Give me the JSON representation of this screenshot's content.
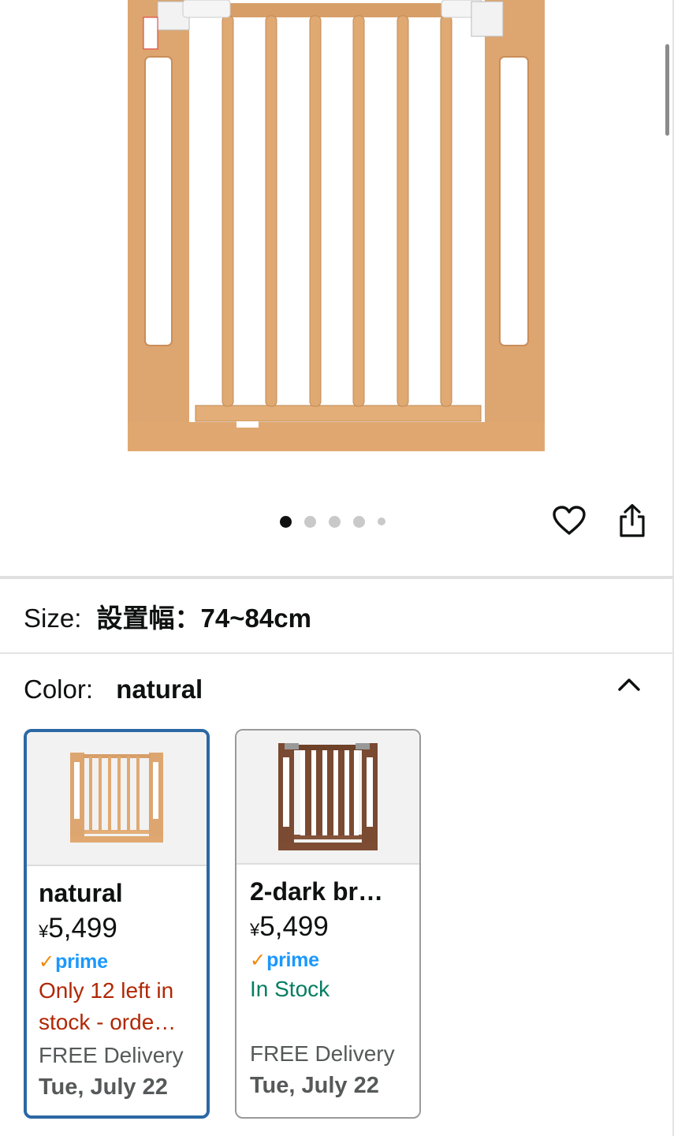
{
  "product_images": {
    "count": 5,
    "active_index": 0
  },
  "actions": {
    "wishlist_icon": "heart-icon",
    "share_icon": "share-icon"
  },
  "size": {
    "label": "Size:",
    "value": "設置幅：74~84cm"
  },
  "color": {
    "label": "Color:",
    "value": "natural",
    "toggle_icon": "chevron-up-icon"
  },
  "swatches": [
    {
      "name": "natural",
      "currency": "¥",
      "price": "5,499",
      "prime": "prime",
      "availability": "Only 12 left in stock - orde…",
      "delivery_label": "FREE Delivery",
      "delivery_date": "Tue, July 22",
      "wood_color": "#d9a46c",
      "selected": true
    },
    {
      "name": "2-dark br…",
      "currency": "¥",
      "price": "5,499",
      "prime": "prime",
      "availability": "In Stock",
      "delivery_label": "FREE Delivery",
      "delivery_date": "Tue, July 22",
      "wood_color": "#7a4a32",
      "selected": false
    }
  ],
  "colors": {
    "accent_selected": "#2c68a4",
    "low_stock": "#b12704",
    "in_stock": "#067d62",
    "prime_blue": "#1a98ff"
  }
}
